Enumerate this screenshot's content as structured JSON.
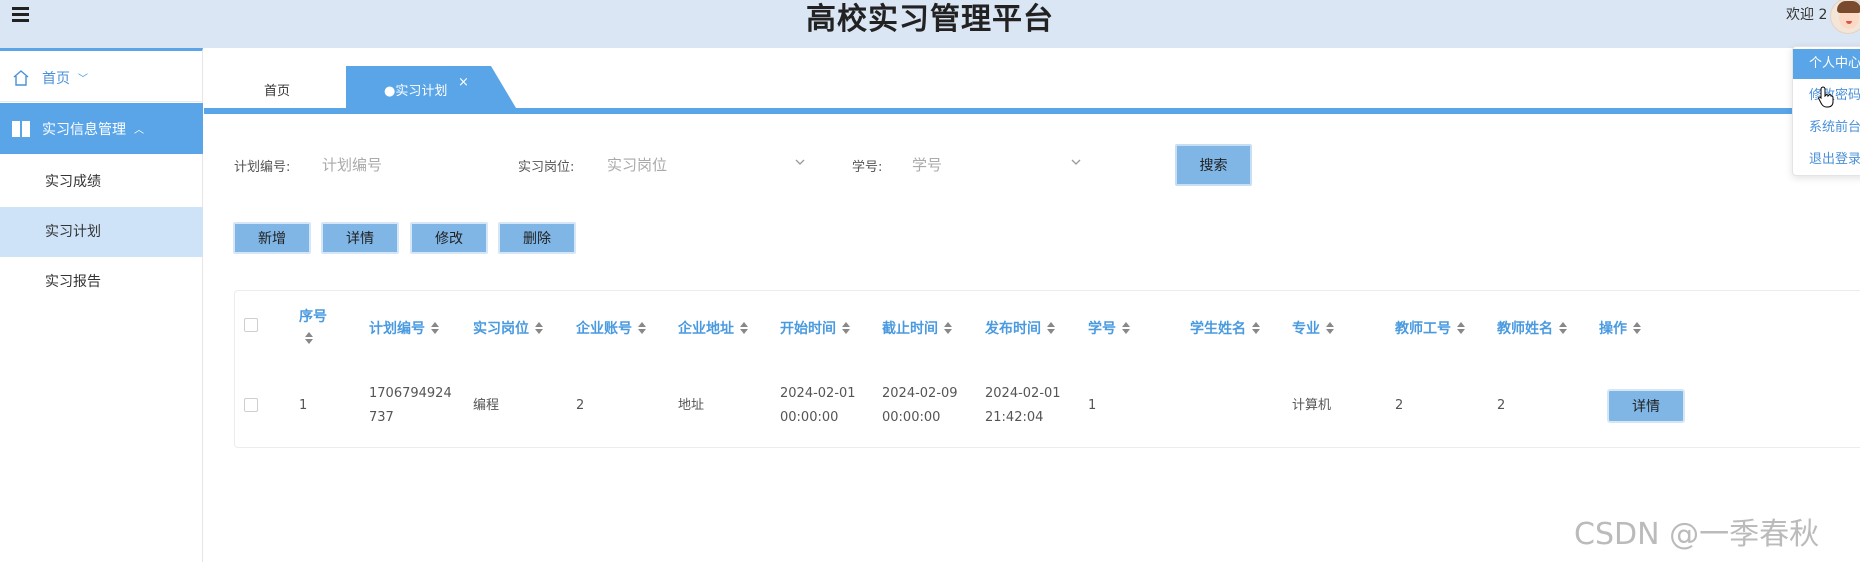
{
  "app": {
    "title": "高校实习管理平台",
    "welcome": "欢迎 2"
  },
  "user_menu": {
    "items": [
      "个人中心",
      "修改密码",
      "系统前台",
      "退出登录"
    ]
  },
  "sidebar": {
    "home": "首页",
    "group": "实习信息管理",
    "items": [
      "实习成绩",
      "实习计划",
      "实习报告"
    ]
  },
  "tabs": {
    "home": "首页",
    "active": "●实习计划",
    "close": "×"
  },
  "search": {
    "plan_no_label": "计划编号:",
    "plan_no_placeholder": "计划编号",
    "post_label": "实习岗位:",
    "post_placeholder": "实习岗位",
    "student_no_label": "学号:",
    "student_no_placeholder": "学号",
    "button": "搜索"
  },
  "actions": {
    "add": "新增",
    "detail": "详情",
    "edit": "修改",
    "delete": "删除"
  },
  "table": {
    "columns": [
      "序号",
      "计划编号",
      "实习岗位",
      "企业账号",
      "企业地址",
      "开始时间",
      "截止时间",
      "发布时间",
      "学号",
      "学生姓名",
      "专业",
      "教师工号",
      "教师姓名",
      "操作"
    ],
    "rows": [
      {
        "index": "1",
        "plan_no_1": "1706794924",
        "plan_no_2": "737",
        "post": "编程",
        "company_account": "2",
        "company_address": "地址",
        "start_1": "2024-02-01",
        "start_2": "00:00:00",
        "end_1": "2024-02-09",
        "end_2": "00:00:00",
        "publish_1": "2024-02-01",
        "publish_2": "21:42:04",
        "student_no": "1",
        "student_name": "",
        "major": "计算机",
        "teacher_no": "2",
        "teacher_name": "2",
        "action": "详情"
      }
    ]
  },
  "watermark": "CSDN @一季春秋",
  "colors": {
    "primary": "#5aa5e8",
    "header_bg": "#dbe6f5",
    "button": "#7fb6e6",
    "active_row": "#cfe3f8"
  }
}
